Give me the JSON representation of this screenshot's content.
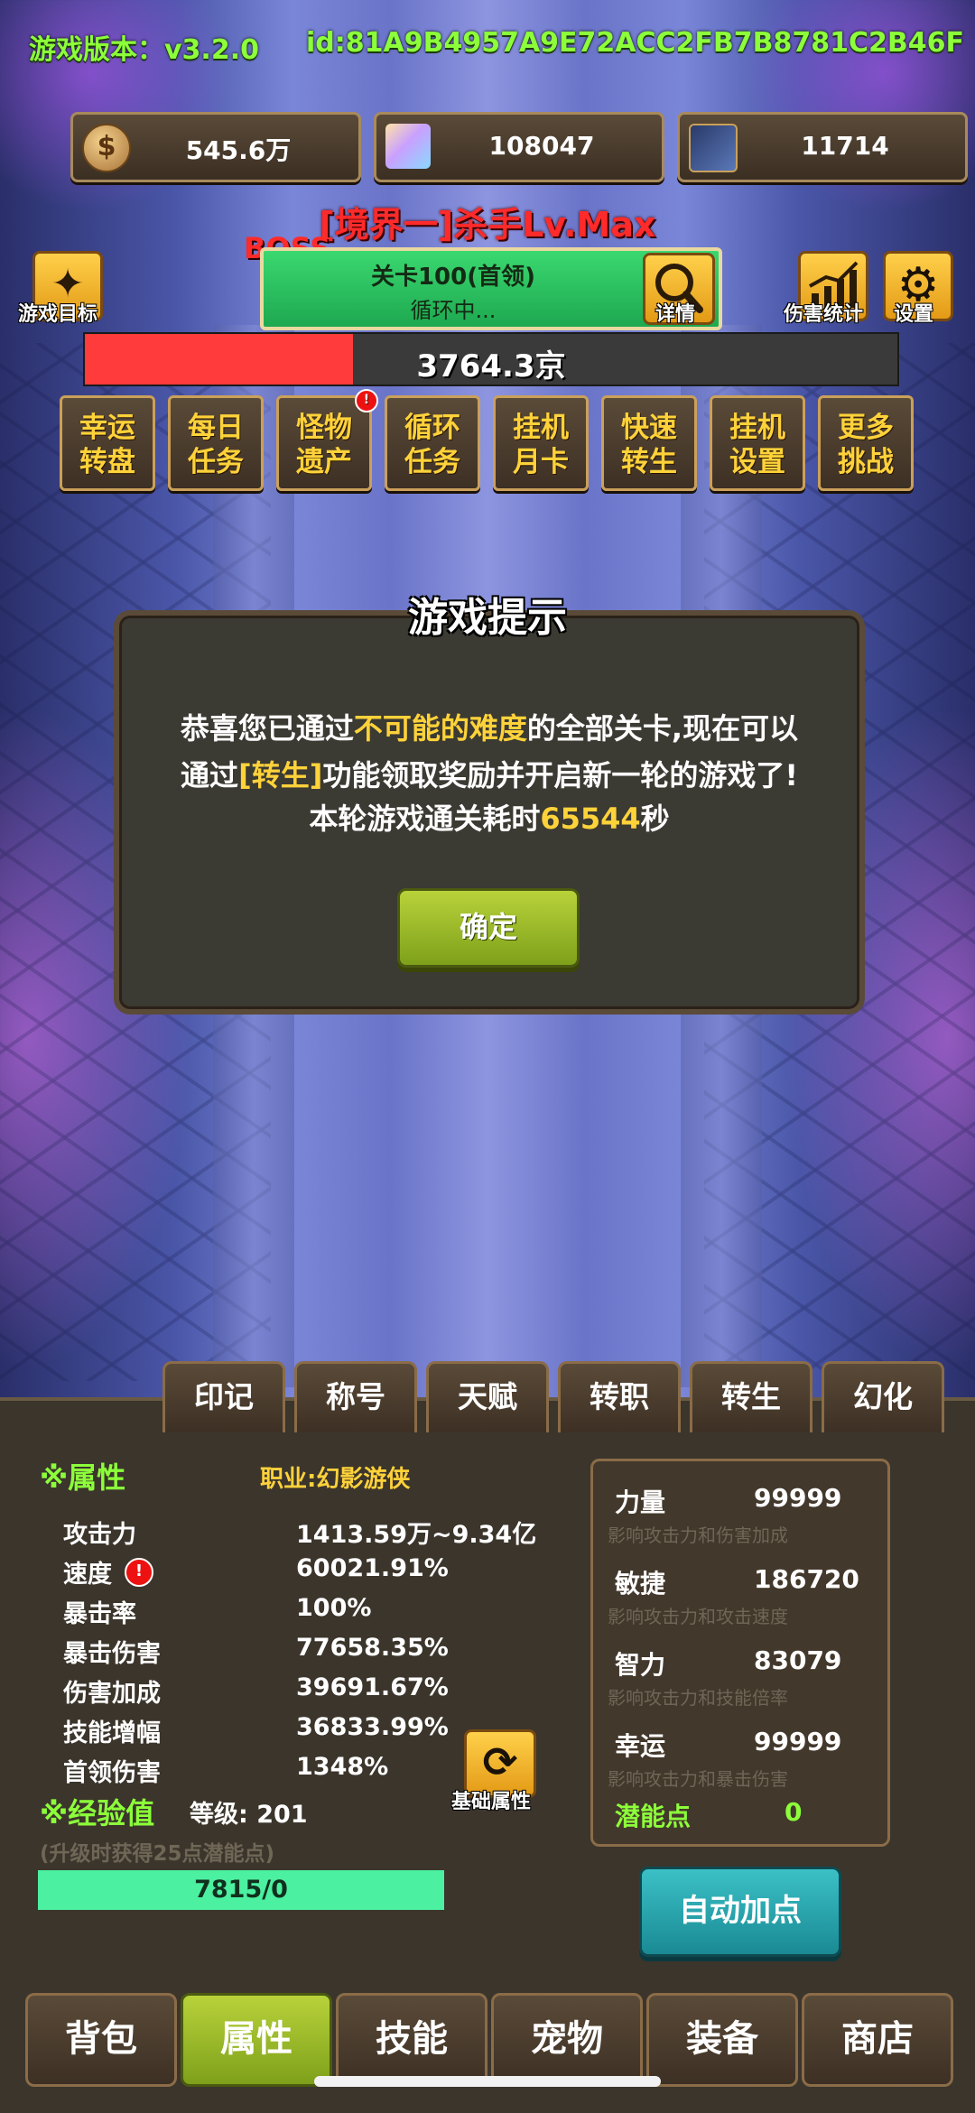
{
  "header": {
    "version": "游戏版本：v3.2.0",
    "user_id": "id:81A9B4957A9E72ACC2FB7B8781C2B46F"
  },
  "resources": [
    {
      "name": "coin-icon",
      "value": "545.6万"
    },
    {
      "name": "crystal-icon",
      "value": "108047"
    },
    {
      "name": "card-icon",
      "value": "11714"
    }
  ],
  "boss": {
    "title": "[境界一]杀手Lv.Max",
    "tag": "BOSS",
    "stage": "关卡100(首领)",
    "status": "循环中...",
    "hp_text": "3764.3京",
    "hp_fraction": 0.33
  },
  "toolbar": {
    "game_goal": "游戏目标",
    "detail": "详情",
    "damage_stats": "伤害统计",
    "settings": "设置"
  },
  "functions": [
    {
      "line1": "幸运",
      "line2": "转盘"
    },
    {
      "line1": "每日",
      "line2": "任务"
    },
    {
      "line1": "怪物",
      "line2": "遗产"
    },
    {
      "line1": "循环",
      "line2": "任务"
    },
    {
      "line1": "挂机",
      "line2": "月卡"
    },
    {
      "line1": "快速",
      "line2": "转生"
    },
    {
      "line1": "挂机",
      "line2": "设置"
    },
    {
      "line1": "更多",
      "line2": "挑战"
    }
  ],
  "notice_badge": "!",
  "dialog": {
    "title": "游戏提示",
    "l1_a": "恭喜您已通过",
    "l1_b": "不可能的难度",
    "l1_c": "的全部关卡,现在可以",
    "l2_a": "通过",
    "l2_b": "[转生]",
    "l2_c": "功能领取奖励并开启新一轮的游戏了!",
    "l3_a": "本轮游戏通关耗时",
    "l3_b": "65544",
    "l3_c": "秒",
    "ok": "确定"
  },
  "panel_tabs": [
    "印记",
    "称号",
    "天赋",
    "转职",
    "转生",
    "幻化"
  ],
  "attributes": {
    "section": "※属性",
    "job": "职业:幻影游侠",
    "stats": [
      {
        "k": "攻击力",
        "v": "1413.59万~9.34亿"
      },
      {
        "k": "速度",
        "v": "60021.91%"
      },
      {
        "k": "暴击率",
        "v": "100%"
      },
      {
        "k": "暴击伤害",
        "v": "77658.35%"
      },
      {
        "k": "伤害加成",
        "v": "39691.67%"
      },
      {
        "k": "技能增幅",
        "v": "36833.99%"
      },
      {
        "k": "首领伤害",
        "v": "1348%"
      }
    ],
    "swap_label": "基础属性"
  },
  "exp": {
    "section": "※经验值",
    "level": "等级: 201",
    "hint": "(升级时获得25点潜能点)",
    "value": "7815/0"
  },
  "base_attrs": [
    {
      "k": "力量",
      "v": "99999",
      "d": "影响攻击力和伤害加成"
    },
    {
      "k": "敏捷",
      "v": "186720",
      "d": "影响攻击力和攻击速度"
    },
    {
      "k": "智力",
      "v": "83079",
      "d": "影响攻击力和技能倍率"
    },
    {
      "k": "幸运",
      "v": "99999",
      "d": "影响攻击力和暴击伤害"
    }
  ],
  "potential": {
    "k": "潜能点",
    "v": "0"
  },
  "auto_btn": "自动加点",
  "bottom_tabs": [
    "背包",
    "属性",
    "技能",
    "宠物",
    "装备",
    "商店"
  ],
  "active_bottom_tab": 1
}
